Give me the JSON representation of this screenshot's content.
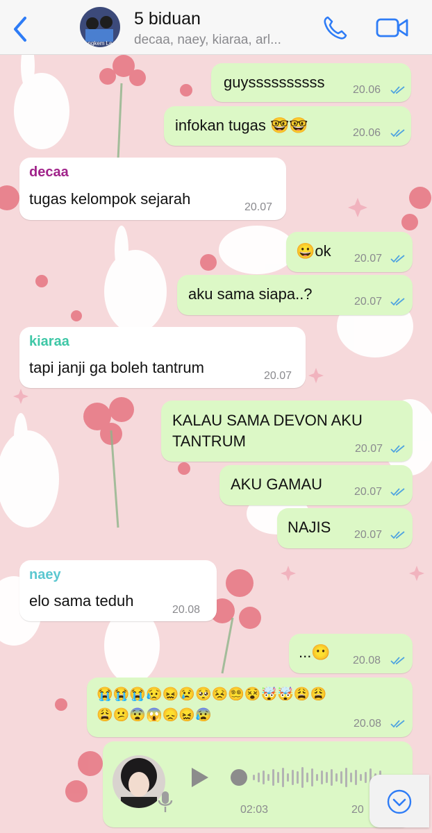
{
  "header": {
    "title": "5 biduan",
    "members": "decaa, naey, kiaraa, arl...",
    "avatar_caption": "ngkem Le",
    "icons": {
      "back": "chevron-left-icon",
      "call": "phone-icon",
      "video": "video-camera-icon"
    }
  },
  "colors": {
    "outgoing": "#dcf8c6",
    "incoming": "#ffffff",
    "read_tick": "#4fa3e0",
    "decaa": "#a0238a",
    "kiaraa": "#3ec7a6",
    "naey": "#5bc7d0"
  },
  "messages": [
    {
      "dir": "out",
      "text": "guyssssssssss",
      "time": "20.06"
    },
    {
      "dir": "out",
      "text": "infokan tugas 🤓🤓",
      "time": "20.06"
    },
    {
      "dir": "in",
      "sender": "decaa",
      "text": "tugas kelompok sejarah",
      "time": "20.07"
    },
    {
      "dir": "out",
      "text": "😀ok",
      "time": "20.07"
    },
    {
      "dir": "out",
      "text": "aku sama siapa..?",
      "time": "20.07"
    },
    {
      "dir": "in",
      "sender": "kiaraa",
      "text": "tapi janji ga boleh tantrum",
      "time": "20.07"
    },
    {
      "dir": "out",
      "text_line1": "KALAU SAMA DEVON AKU",
      "text_line2": "TANTRUM",
      "time": "20.07"
    },
    {
      "dir": "out",
      "text": "AKU GAMAU",
      "time": "20.07"
    },
    {
      "dir": "out",
      "text": "NAJIS",
      "time": "20.07"
    },
    {
      "dir": "in",
      "sender": "naey",
      "text": "elo sama teduh",
      "time": "20.08"
    },
    {
      "dir": "out",
      "text": "...😶",
      "time": "20.08"
    },
    {
      "dir": "out",
      "text_line1": "😭😭😭😥😖😢🥺😣😵‍💫😵🤯🤯😩😩",
      "text_line2": "😩😕😨😱😞😖😰",
      "time": "20.08"
    },
    {
      "dir": "out",
      "type": "voice",
      "duration": "02:03",
      "time": "20"
    }
  ],
  "scroll_icon": "chevron-down-icon"
}
